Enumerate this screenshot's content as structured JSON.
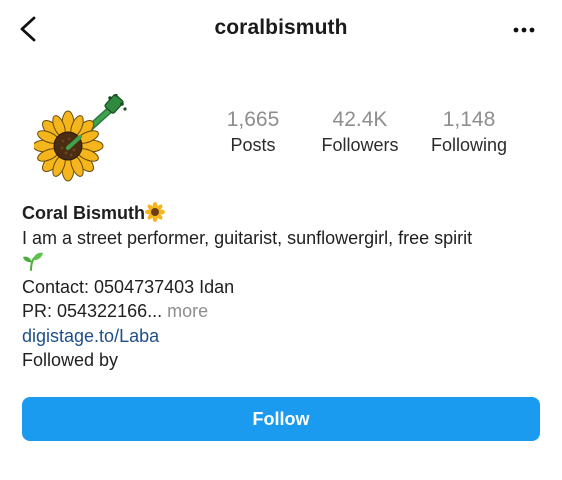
{
  "header": {
    "username": "coralbismuth",
    "back_icon": "chevron-left-icon",
    "more_icon": "more-horizontal-icon"
  },
  "avatar": {
    "icon": "sunflower-guitar-icon"
  },
  "stats": [
    {
      "value": "1,665",
      "label": "Posts"
    },
    {
      "value": "42.4K",
      "label": "Followers"
    },
    {
      "value": "1,148",
      "label": "Following"
    }
  ],
  "bio": {
    "name": "Coral Bismuth",
    "name_emoji": "sunflower-icon",
    "line1": "I am a street performer, guitarist, sunflowergirl, free spirit",
    "line2_emoji": "seedling-icon",
    "contact": "Contact: 0504737403 Idan",
    "pr": "PR: 054322166...",
    "more": " more",
    "link": "digistage.to/Laba",
    "followed_by": "Followed by"
  },
  "actions": {
    "follow_label": "Follow"
  },
  "colors": {
    "follow_button": "#1a9bef",
    "link": "#1e4f8a",
    "muted": "#8e8e8e"
  }
}
